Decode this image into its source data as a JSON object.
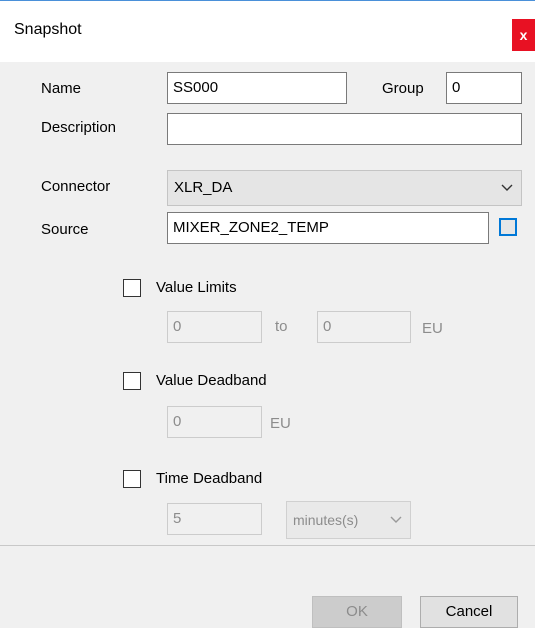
{
  "window": {
    "title": "Snapshot",
    "close_glyph": "x"
  },
  "form": {
    "name_label": "Name",
    "name_value": "SS000",
    "group_label": "Group",
    "group_value": "0",
    "description_label": "Description",
    "description_value": "",
    "connector_label": "Connector",
    "connector_value": "XLR_DA",
    "source_label": "Source",
    "source_value": "MIXER_ZONE2_TEMP"
  },
  "value_limits": {
    "label": "Value Limits",
    "checked": false,
    "from": "0",
    "to_label": "to",
    "to": "0",
    "unit": "EU"
  },
  "value_deadband": {
    "label": "Value Deadband",
    "checked": false,
    "value": "0",
    "unit": "EU"
  },
  "time_deadband": {
    "label": "Time Deadband",
    "checked": false,
    "value": "5",
    "unit_value": "minutes(s)"
  },
  "buttons": {
    "ok": "OK",
    "cancel": "Cancel"
  },
  "icons": {
    "close": "close-icon",
    "dropdown": "chevron-down-icon",
    "browse": "browse-icon"
  }
}
